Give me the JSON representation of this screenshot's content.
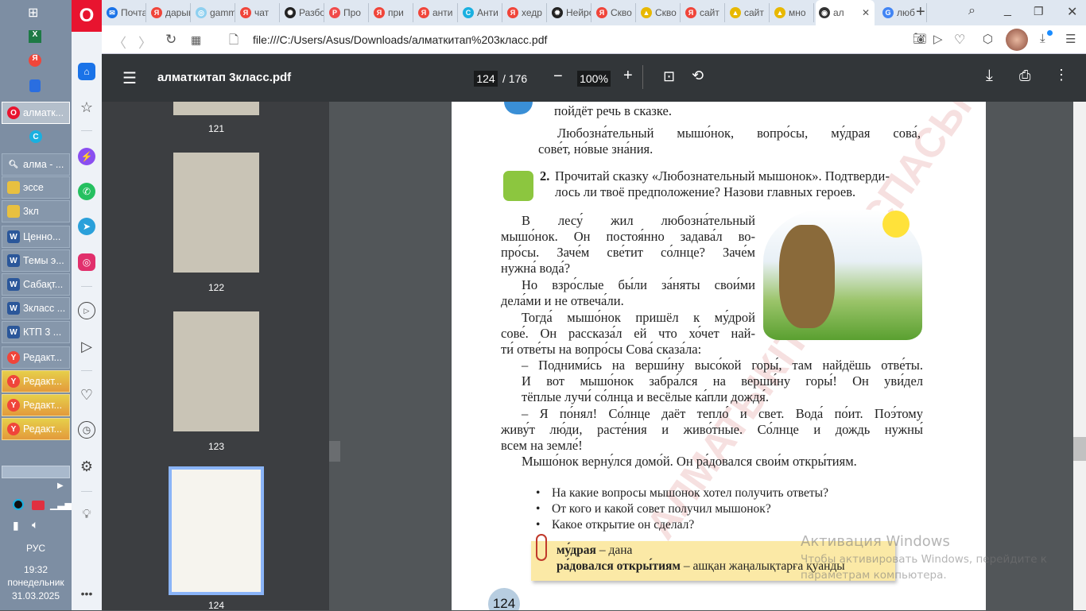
{
  "taskbar": {
    "items": [
      {
        "label": "алматк...",
        "icon": "opera-icon",
        "state": "active"
      },
      {
        "label": "",
        "icon": "c-app-icon",
        "state": "normal"
      },
      {
        "label": "алма - ...",
        "icon": "search-icon",
        "state": "normal"
      },
      {
        "label": "эссе",
        "icon": "folder-icon",
        "state": "normal"
      },
      {
        "label": "3кл",
        "icon": "folder-icon",
        "state": "normal"
      },
      {
        "label": "Ценно...",
        "icon": "word-icon",
        "state": "normal"
      },
      {
        "label": "Темы э...",
        "icon": "word-icon",
        "state": "normal"
      },
      {
        "label": "Сабақт...",
        "icon": "word-icon",
        "state": "normal"
      },
      {
        "label": "3класс ...",
        "icon": "word-icon",
        "state": "normal"
      },
      {
        "label": "КТП 3 ...",
        "icon": "word-icon",
        "state": "normal"
      },
      {
        "label": "Редакт...",
        "icon": "yandex-icon",
        "state": "normal"
      },
      {
        "label": "Редакт...",
        "icon": "yandex-icon",
        "state": "flashing"
      },
      {
        "label": "Редакт...",
        "icon": "yandex-icon",
        "state": "flashing"
      },
      {
        "label": "Редакт...",
        "icon": "yandex-icon",
        "state": "flashing"
      }
    ],
    "language": "РУС",
    "time": "19:32",
    "weekday": "понедельник",
    "date": "31.03.2025"
  },
  "browser": {
    "tabs": [
      {
        "label": "Почта",
        "color": "#1a73e8",
        "glyph": "✉"
      },
      {
        "label": "дарын",
        "color": "#f0453a",
        "glyph": "Я"
      },
      {
        "label": "gamma",
        "color": "#8fd0f0",
        "glyph": "◎"
      },
      {
        "label": "чат",
        "color": "#f0453a",
        "glyph": "Я"
      },
      {
        "label": "Разбор",
        "color": "#222",
        "glyph": "✺"
      },
      {
        "label": "Про",
        "color": "#f04a4a",
        "glyph": "P"
      },
      {
        "label": "при",
        "color": "#f0453a",
        "glyph": "Я"
      },
      {
        "label": "анти",
        "color": "#f0453a",
        "glyph": "Я"
      },
      {
        "label": "Анти",
        "color": "#1ab0e0",
        "glyph": "C"
      },
      {
        "label": "хедр",
        "color": "#f0453a",
        "glyph": "Я"
      },
      {
        "label": "Нейро",
        "color": "#222",
        "glyph": "✹"
      },
      {
        "label": "Скво",
        "color": "#f0453a",
        "glyph": "Я"
      },
      {
        "label": "Скво",
        "color": "#e8b800",
        "glyph": "▲"
      },
      {
        "label": "сайт",
        "color": "#f0453a",
        "glyph": "Я"
      },
      {
        "label": "сайт",
        "color": "#e8b800",
        "glyph": "▲"
      },
      {
        "label": "мно",
        "color": "#e8b800",
        "glyph": "▲"
      },
      {
        "label": "ал",
        "color": "#333",
        "glyph": "◉",
        "active": true
      },
      {
        "label": "люб",
        "color": "#4285f4",
        "glyph": "G"
      }
    ],
    "url": "file:///C:/Users/Asus/Downloads/алматкитап%203класс.pdf"
  },
  "pdf": {
    "title": "алматкитап 3класс.pdf",
    "current_page": "124",
    "total_pages": "/ 176",
    "zoom": "100%",
    "thumbnails": [
      {
        "label": "121"
      },
      {
        "label": "122"
      },
      {
        "label": "123"
      },
      {
        "label": "124",
        "selected": true
      }
    ]
  },
  "page": {
    "intro_tail": "пойдёт речь в сказке.",
    "keywords_l1": "Любозна́тельный мышо́нок, вопро́сы, му́драя сова́,",
    "keywords_l2": "сове́т, но́вые зна́ния.",
    "task_num": "2.",
    "task_l1": "Прочитай сказку «Любознательный мышонок». Подтверди-",
    "task_l2": "лось ли твоё предположение? Назови главных героев.",
    "story": [
      "В лесу́ жил любозна́тельный",
      "мышо́нок. Он постоя́нно задава́л во-",
      "про́сы. Заче́м све́тит со́лнце? Заче́м",
      "нужна́ вода́?",
      "Но взро́слые бы́ли за́няты свои́ми",
      "дела́ми и не отвеча́ли.",
      "Тогда́ мышо́нок пришёл к му́дрой",
      "сове́. Он рассказа́л ей что хо́чет най-",
      "ти́ отве́ты на вопро́сы Сова́ сказа́ла:",
      "– Подними́сь на верши́ну высо́кой горы́, там найдёшь отве́ты.",
      "И вот мышо́нок забра́лся на верши́ну горы́! Он уви́дел",
      "тёплые лучи́ со́лнца и весёлые ка́пли дождя́.",
      "– Я по́нял! Со́лнце даёт тепло́ и свет. Вода́ по́ит. Поэ́тому",
      "живу́т лю́ди, расте́ния и живо́тные. Со́лнце и дождь нужны́",
      "всем на земле́!",
      "Мышо́нок верну́лся домо́й. Он ра́довался свои́м откры́тиям."
    ],
    "questions": [
      "На какие вопросы мышонок хотел получить ответы?",
      "От кого и какой совет получил мышонок?",
      "Какое открытие он сделал?"
    ],
    "vocab": [
      {
        "term": "му́драя",
        "translation": "– дана"
      },
      {
        "term": "ра́довался откры́тиям",
        "translation": "– ашқан жаңалықтарға қуанды"
      }
    ],
    "page_number": "124",
    "stamp": "АЛМАТЫКІТАП БАСПАСЫ"
  },
  "activation": {
    "title": "Активация Windows",
    "line1": "Чтобы активировать Windows, перейдите к",
    "line2": "параметрам компьютера."
  },
  "colors": {
    "opera_red": "#e8142f",
    "pdf_toolbar": "#323639",
    "taskbar": "#7d8ea3",
    "vocab_bg": "#fbe9a6"
  }
}
